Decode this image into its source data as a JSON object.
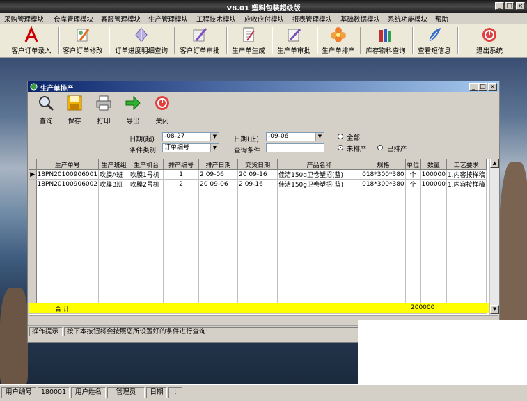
{
  "app": {
    "title": "V8.01 塑料包装超级版"
  },
  "menu": [
    "采购管理模块",
    "仓库管理模块",
    "客服管理模块",
    "生产管理模块",
    "工程技术模块",
    "应收应付模块",
    "报表管理模块",
    "基础数据模块",
    "系统功能模块",
    "帮助"
  ],
  "toolbar": [
    {
      "label": "客户订单录入",
      "icon": "pdf-pen-icon"
    },
    {
      "label": "客户订单修改",
      "icon": "pen-edit-icon"
    },
    {
      "label": "订单进度明细查询",
      "icon": "crystal-icon"
    },
    {
      "label": "客户订单审批",
      "icon": "pen-approve-icon"
    },
    {
      "label": "生产单生成",
      "icon": "document-icon"
    },
    {
      "label": "生产单审批",
      "icon": "pen-check-icon"
    },
    {
      "label": "生产单排产",
      "icon": "flower-icon"
    },
    {
      "label": "库存物料查询",
      "icon": "books-icon"
    },
    {
      "label": "查看短信息",
      "icon": "feather-icon"
    },
    {
      "label": "退出系统",
      "icon": "power-icon"
    }
  ],
  "inner_window": {
    "title": "生产单排产",
    "toolbar": [
      {
        "label": "查询",
        "icon": "magnifier-icon"
      },
      {
        "label": "保存",
        "icon": "floppy-icon"
      },
      {
        "label": "打印",
        "icon": "printer-icon"
      },
      {
        "label": "导出",
        "icon": "arrow-right-icon"
      },
      {
        "label": "关闭",
        "icon": "power-icon"
      }
    ],
    "filter": {
      "date_from_label": "日期(起)",
      "date_from_value": "-08-27",
      "date_to_label": "日期(止)",
      "date_to_value": "-09-06",
      "category_label": "条件类别",
      "category_value": "订单编号",
      "query_label": "查询条件",
      "query_value": "",
      "radio_all": "全部",
      "radio_unscheduled": "未排产",
      "radio_scheduled": "已排产"
    },
    "grid": {
      "columns": [
        "生产单号",
        "生产班组",
        "生产机台",
        "排产编号",
        "排产日期",
        "交货日期",
        "产品名称",
        "规格",
        "单位",
        "数量",
        "工艺要求"
      ],
      "rows": [
        [
          "18PN20100906001",
          "吹膜A班",
          "吹膜1号机",
          "1",
          "2 09-06",
          "20 09-16",
          "佳洁150g卫卷塑招(蓝)",
          "018*300*380",
          "个",
          "100000",
          "1.内容按样稿"
        ],
        [
          "18PN20100906002",
          "吹膜B班",
          "吹膜2号机",
          "2",
          "20 09-06",
          "2 09-16",
          "佳洁150g卫卷塑招(蓝)",
          "018*300*380",
          "个",
          "100000",
          "1.内容按样稿"
        ]
      ],
      "total_label": "合 计",
      "total_qty": "200000"
    },
    "status": {
      "label": "操作提示",
      "message": "按下本按钮将会按照您所设置好的条件进行查询!"
    }
  },
  "statusbar": {
    "user_id_label": "用户编号",
    "user_id": "180001",
    "user_name_label": "用户姓名",
    "user_name": "管理员",
    "date_label": "日期",
    "date_value": ";"
  }
}
